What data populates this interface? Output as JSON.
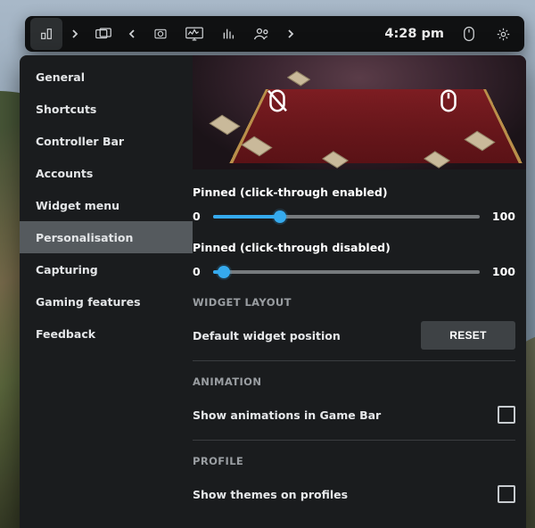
{
  "toolbar": {
    "time": "4:28 pm"
  },
  "sidebar": {
    "items": [
      {
        "label": "General"
      },
      {
        "label": "Shortcuts"
      },
      {
        "label": "Controller Bar"
      },
      {
        "label": "Accounts"
      },
      {
        "label": "Widget menu"
      },
      {
        "label": "Personalisation",
        "selected": true
      },
      {
        "label": "Capturing"
      },
      {
        "label": "Gaming features"
      },
      {
        "label": "Feedback"
      }
    ]
  },
  "opacity": {
    "pinned_enabled": {
      "label": "Pinned (click-through enabled)",
      "min_label": "0",
      "max_label": "100",
      "value": 30
    },
    "pinned_disabled": {
      "label": "Pinned (click-through disabled)",
      "min_label": "0",
      "max_label": "100",
      "value": 4
    }
  },
  "widget_layout": {
    "title": "WIDGET LAYOUT",
    "row_label": "Default widget position",
    "reset_label": "RESET"
  },
  "animation": {
    "title": "ANIMATION",
    "row_label": "Show animations in Game Bar",
    "checked": false
  },
  "profile": {
    "title": "PROFILE",
    "row_label": "Show themes on profiles",
    "checked": false
  }
}
